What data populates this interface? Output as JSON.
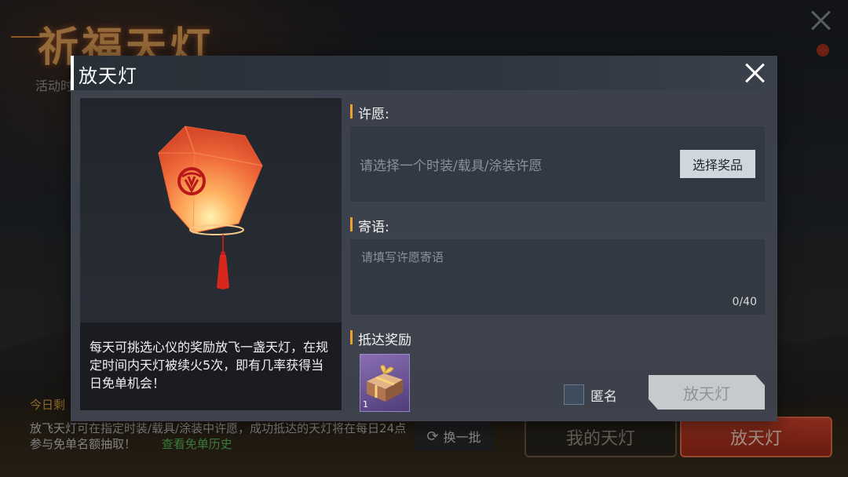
{
  "background": {
    "event_title": "祈福天灯",
    "event_subtitle": "活动时",
    "today_remaining": "今日剩",
    "description": "放飞天灯可在指定时装/载具/涂装中许愿，成功抵达的天灯将在每日24点参与免单名额抽取！",
    "history_link": "查看免单历史",
    "refresh_button": "换一批",
    "my_lanterns_button": "我的天灯",
    "release_button": "放天灯"
  },
  "modal": {
    "title": "放天灯",
    "description": "每天可挑选心仪的奖励放飞一盏天灯，在规定时间内天灯被续火5次，即有几率获得当日免单机会！",
    "wish": {
      "label": "许愿:",
      "placeholder": "请选择一个时装/载具/涂装许愿",
      "choose_button": "选择奖品"
    },
    "message": {
      "label": "寄语:",
      "placeholder": "请填写许愿寄语",
      "counter": "0/40"
    },
    "reward": {
      "label": "抵达奖励",
      "item_count": "1",
      "item_icon": "gift-box-icon"
    },
    "anonymous_label": "匿名",
    "anonymous_checked": false,
    "release_button": "放天灯"
  },
  "colors": {
    "accent_orange": "#f0a030",
    "lantern_red": "#e8542a",
    "item_purple": "#6b56a0",
    "link_green": "#5dbd5a"
  }
}
